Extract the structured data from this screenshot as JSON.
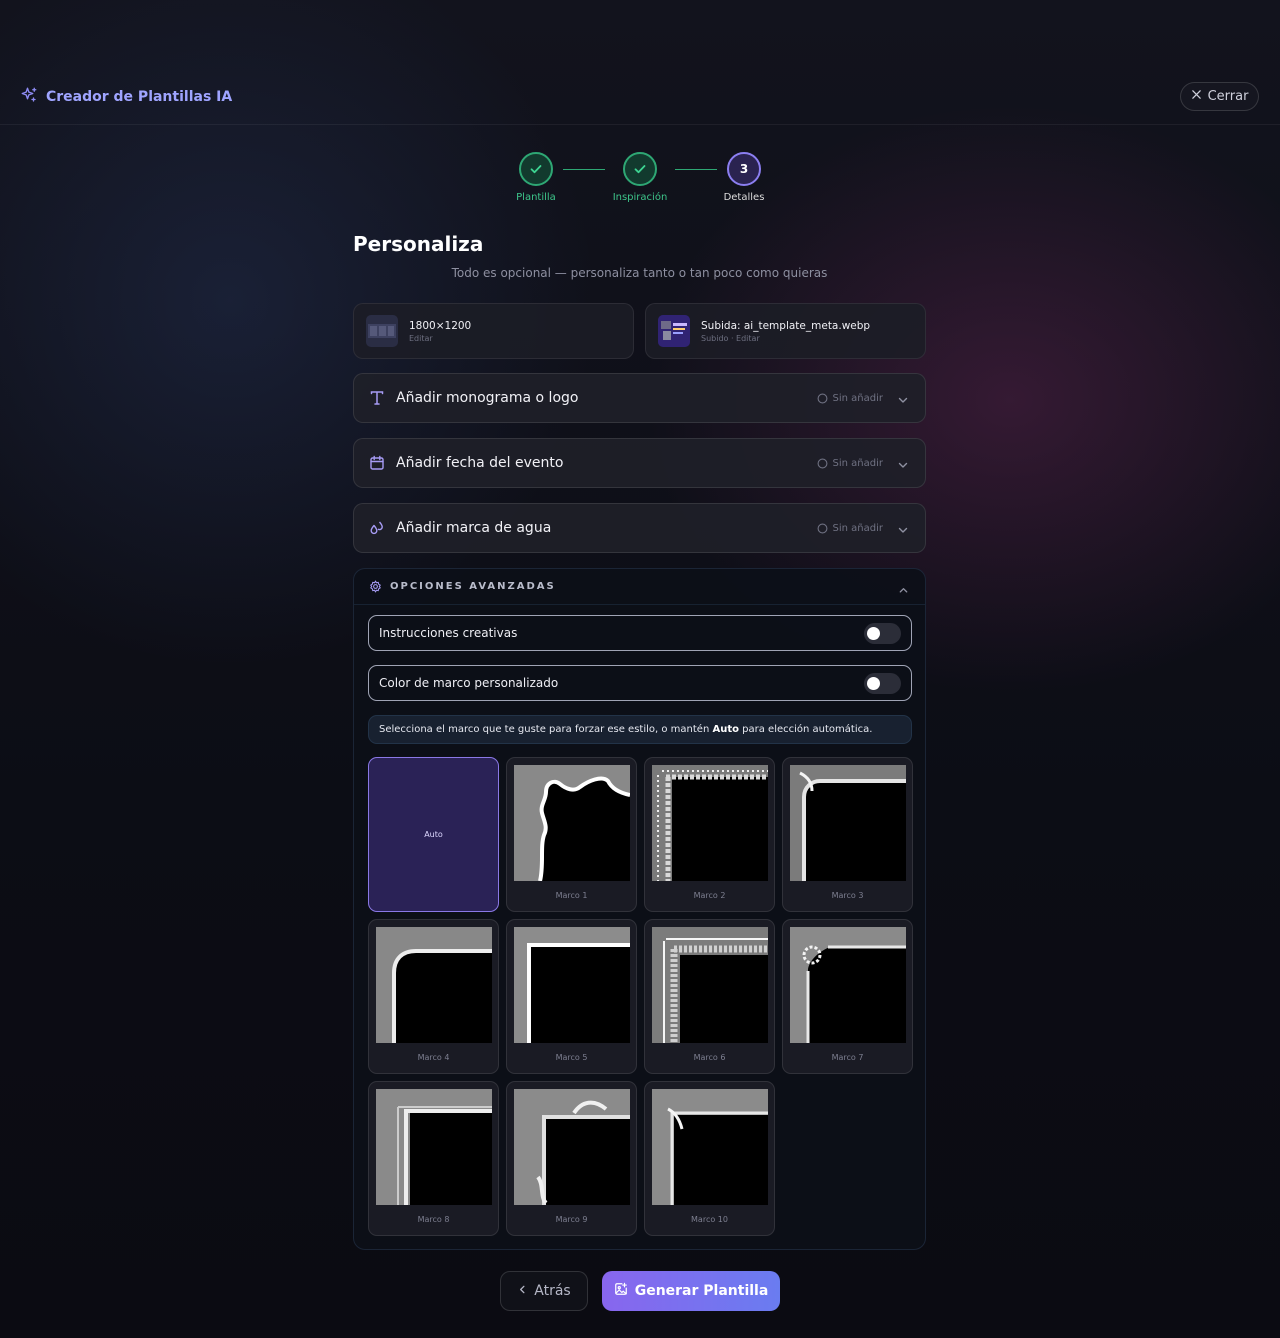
{
  "header": {
    "title": "Creador de Plantillas IA",
    "close_label": "Cerrar"
  },
  "steps": [
    {
      "label": "Plantilla",
      "state": "done"
    },
    {
      "label": "Inspiración",
      "state": "done"
    },
    {
      "label": "Detalles",
      "state": "current",
      "number": "3"
    }
  ],
  "page": {
    "title": "Personaliza",
    "subtitle": "Todo es opcional — personaliza tanto o tan poco como quieras"
  },
  "cards": [
    {
      "main": "1800×1200",
      "sub": "Editar"
    },
    {
      "main": "Subida: ai_template_meta.webp",
      "sub": "Subido · Editar"
    }
  ],
  "accordions": [
    {
      "title": "Añadir monograma o logo",
      "status": "Sin añadir",
      "icon": "text-icon"
    },
    {
      "title": "Añadir fecha del evento",
      "status": "Sin añadir",
      "icon": "calendar-icon"
    },
    {
      "title": "Añadir marca de agua",
      "status": "Sin añadir",
      "icon": "droplets-icon"
    }
  ],
  "advanced": {
    "title": "OPCIONES AVANZADAS",
    "toggles": [
      {
        "label": "Instrucciones creativas",
        "on": false
      },
      {
        "label": "Color de marco personalizado",
        "on": false
      }
    ],
    "info_pre": "Selecciona el marco que te guste para forzar ese estilo, o mantén ",
    "info_bold": "Auto",
    "info_post": " para elección automática.",
    "auto_label": "Auto",
    "frames": [
      "Marco 1",
      "Marco 2",
      "Marco 3",
      "Marco 4",
      "Marco 5",
      "Marco 6",
      "Marco 7",
      "Marco 8",
      "Marco 9",
      "Marco 10"
    ]
  },
  "footer": {
    "back_label": "Atrás",
    "generate_label": "Generar Plantilla"
  },
  "colors": {
    "accent": "#8b7ef0",
    "success": "#2ea774",
    "background": "#0c0d15"
  }
}
